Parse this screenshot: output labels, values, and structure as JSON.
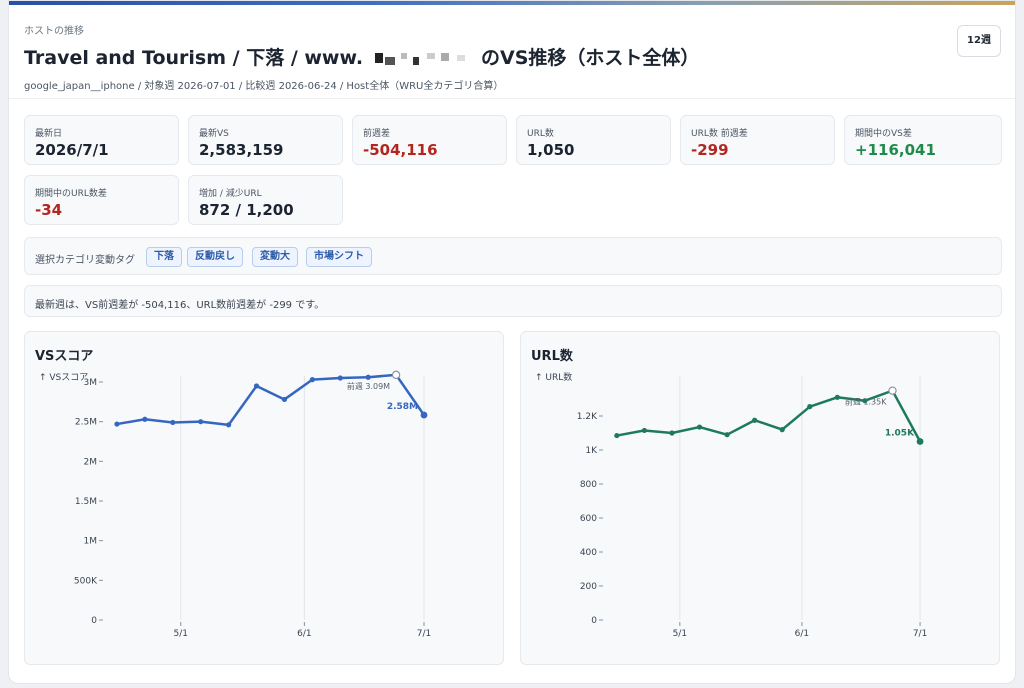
{
  "header": {
    "eyebrow": "ホストの推移",
    "title_prefix": "Travel and Tourism / 下落 / www.",
    "title_suffix": "のVS推移（ホスト全体）",
    "subtitle": "google_japan__iphone / 対象週 2026-07-01 / 比較週 2026-06-24 / Host全体（WRU全カテゴリ合算）",
    "weeks_button": "12週"
  },
  "metrics": [
    {
      "label": "最新日",
      "value": "2026/7/1",
      "tone": "normal"
    },
    {
      "label": "最新VS",
      "value": "2,583,159",
      "tone": "normal"
    },
    {
      "label": "前週差",
      "value": "-504,116",
      "tone": "neg"
    },
    {
      "label": "URL数",
      "value": "1,050",
      "tone": "normal"
    },
    {
      "label": "URL数 前週差",
      "value": "-299",
      "tone": "neg"
    },
    {
      "label": "期間中のVS差",
      "value": "+116,041",
      "tone": "pos"
    },
    {
      "label": "期間中のURL数差",
      "value": "-34",
      "tone": "neg"
    },
    {
      "label": "増加 / 減少URL",
      "value": "872 / 1,200",
      "tone": "normal"
    }
  ],
  "tags": {
    "label": "選択カテゴリ変動タグ",
    "items": [
      "下落",
      "反動戻し",
      "変動大",
      "市場シフト"
    ]
  },
  "note": "最新週は、VS前週差が -504,116、URL数前週差が -299 です。",
  "colors": {
    "vs_line": "#3567c0",
    "url_line": "#1e7a5c",
    "neg": "#b3261e",
    "pos": "#1f8a4c"
  },
  "chart_data": [
    {
      "type": "line",
      "title": "VSスコア",
      "ylabel": "↑ VSスコア",
      "x_ticks": [
        "5/1",
        "6/1",
        "7/1"
      ],
      "ylim": [
        0,
        3000000
      ],
      "y_ticks": [
        0,
        500000,
        1000000,
        1500000,
        2000000,
        2500000,
        3000000
      ],
      "y_tick_labels": [
        "0",
        "500K",
        "1M",
        "1.5M",
        "2M",
        "2.5M",
        "3M"
      ],
      "x": [
        "2026-04-15",
        "2026-04-22",
        "2026-04-29",
        "2026-05-06",
        "2026-05-13",
        "2026-05-20",
        "2026-05-27",
        "2026-06-03",
        "2026-06-10",
        "2026-06-17",
        "2026-06-24",
        "2026-07-01"
      ],
      "values": [
        2470000,
        2530000,
        2490000,
        2500000,
        2460000,
        2950000,
        2780000,
        3030000,
        3050000,
        3060000,
        3090000,
        2583159
      ],
      "prev_week_label": "前週 3.09M",
      "last_label": "2.58M",
      "grid": true
    },
    {
      "type": "line",
      "title": "URL数",
      "ylabel": "↑ URL数",
      "x_ticks": [
        "5/1",
        "6/1",
        "7/1"
      ],
      "ylim": [
        0,
        1400
      ],
      "y_ticks": [
        0,
        200,
        400,
        600,
        800,
        1000,
        1200
      ],
      "y_tick_labels": [
        "0",
        "200",
        "400",
        "600",
        "800",
        "1K",
        "1.2K"
      ],
      "x": [
        "2026-04-15",
        "2026-04-22",
        "2026-04-29",
        "2026-05-06",
        "2026-05-13",
        "2026-05-20",
        "2026-05-27",
        "2026-06-03",
        "2026-06-10",
        "2026-06-17",
        "2026-06-24",
        "2026-07-01"
      ],
      "values": [
        1085,
        1115,
        1100,
        1135,
        1090,
        1175,
        1120,
        1255,
        1310,
        1290,
        1349,
        1050
      ],
      "prev_week_label": "前週 1.35K",
      "last_label": "1.05K",
      "grid": true
    }
  ]
}
